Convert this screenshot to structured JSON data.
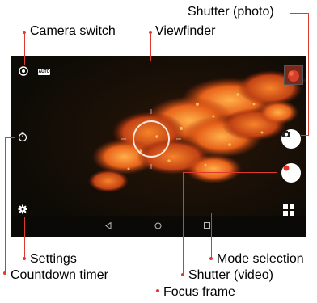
{
  "callouts": {
    "camera_switch": "Camera switch",
    "viewfinder": "Viewfinder",
    "shutter_photo": "Shutter (photo)",
    "settings": "Settings",
    "countdown_timer": "Countdown timer",
    "mode_selection": "Mode selection",
    "shutter_video": "Shutter (video)",
    "focus_frame": "Focus frame"
  },
  "screen": {
    "auto_badge": "AUTO",
    "icons": {
      "camera_switch": "camera-switch-icon",
      "timer": "timer-icon",
      "settings": "gear-icon",
      "mode_selection": "grid-icon",
      "shutter_photo": "camera-icon",
      "shutter_video": "record-dot-icon",
      "nav_back": "back-triangle-icon",
      "nav_home": "home-circle-icon",
      "nav_recent": "recent-square-icon"
    }
  },
  "colors": {
    "callout_line": "#e03a2f",
    "foliage": "#e2631a",
    "record": "#e5322b"
  }
}
